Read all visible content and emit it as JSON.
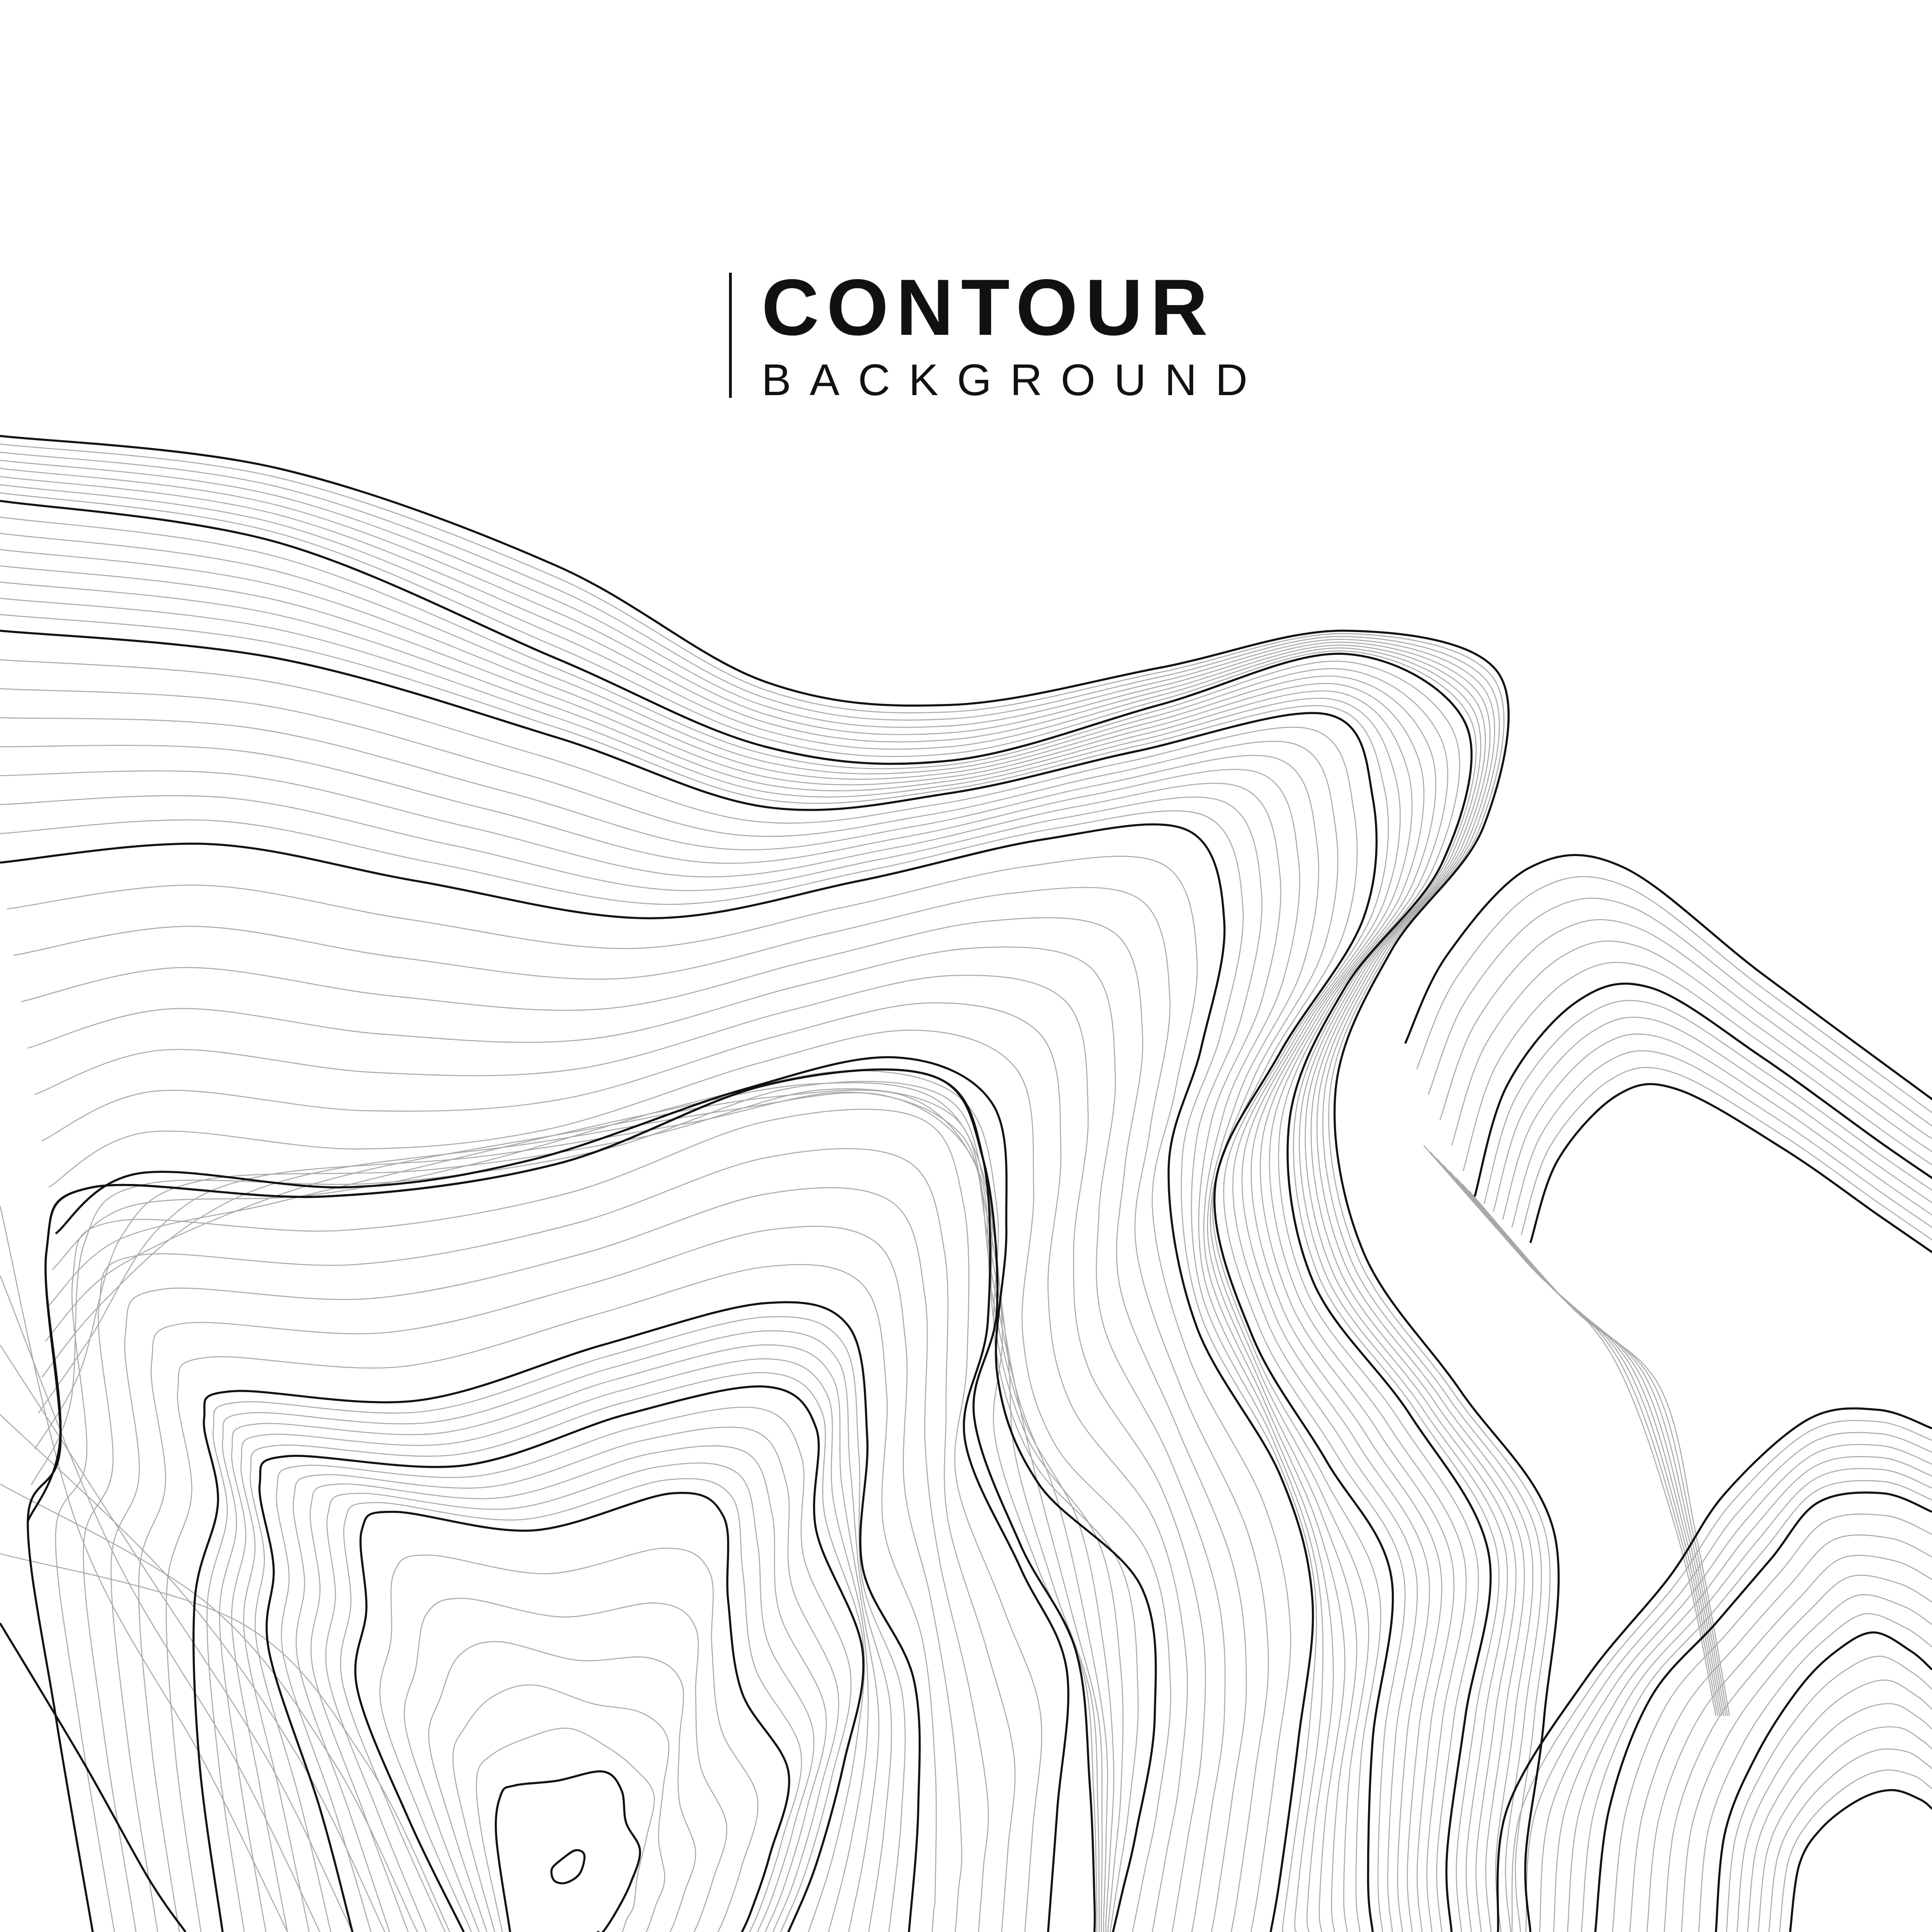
{
  "title": {
    "main": "CONTOUR",
    "sub": "BACKGROUND"
  },
  "colors": {
    "background": "#ffffff",
    "index_line": "#111111",
    "minor_line": "#9a9a9a",
    "text": "#111111"
  },
  "artwork": {
    "description_name": "contour-lines-artwork"
  }
}
